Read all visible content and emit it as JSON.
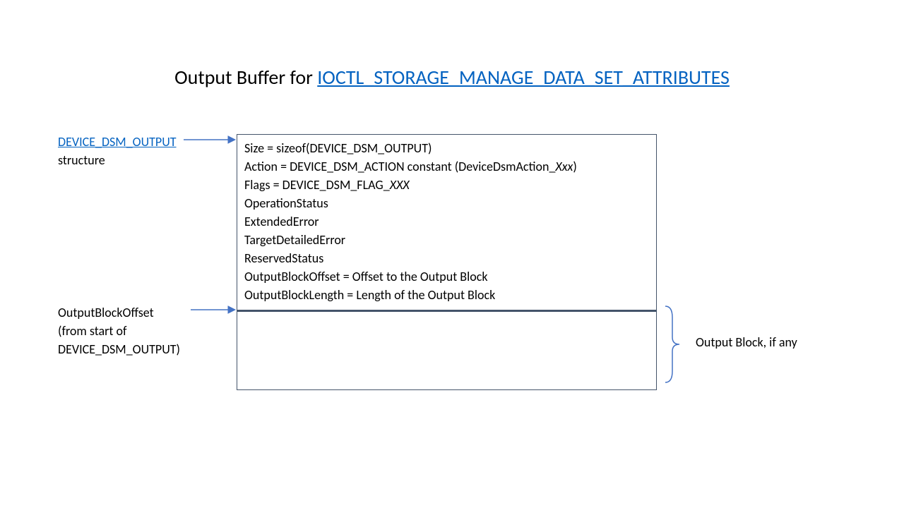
{
  "title": {
    "prefix": "Output Buffer for ",
    "link": "IOCTL_STORAGE_MANAGE_DATA_SET_ATTRIBUTES"
  },
  "leftLabel1": {
    "link": "DEVICE_DSM_OUTPUT",
    "suffix": "structure"
  },
  "leftLabel2": {
    "l1": "OutputBlockOffset",
    "l2": "(from start of",
    "l3": "DEVICE_DSM_OUTPUT)"
  },
  "box": {
    "l1a": "Size  = sizeof(DEVICE_DSM_OUTPUT)",
    "l2a": "Action = DEVICE_DSM_ACTION  constant (DeviceDsmAction_",
    "l2b": "Xxx",
    "l2c": ")",
    "l3a": "Flags = DEVICE_DSM_FLAG_",
    "l3b": "XXX",
    "l4": "OperationStatus",
    "l5": "ExtendedError",
    "l6": "TargetDetailedError",
    "l7": "ReservedStatus",
    "l8": "OutputBlockOffset = Offset to the Output Block",
    "l9": "OutputBlockLength = Length of the Output Block"
  },
  "rightLabel": "Output Block, if any"
}
